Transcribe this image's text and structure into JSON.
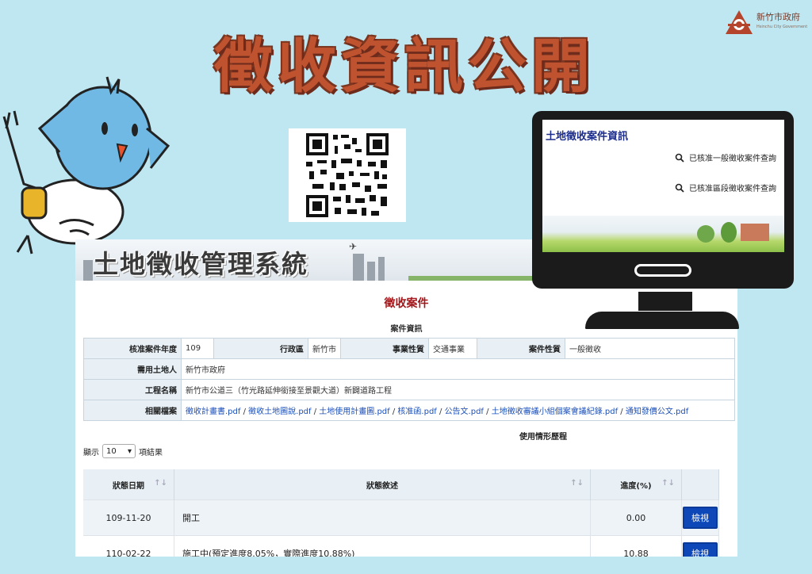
{
  "logo": {
    "name": "新竹市政府",
    "subtitle": "Hsinchu City Government"
  },
  "poster": {
    "title": "徵收資訊公開"
  },
  "system": {
    "banner_title": "土地徵收管理系統",
    "page_heading": "徵收案件",
    "section_heading": "案件資訊",
    "info": {
      "year_label": "核准案件年度",
      "year_value": "109",
      "district_label": "行政區",
      "district_value": "新竹市",
      "business_label": "事業性質",
      "business_value": "交通事業",
      "case_type_label": "案件性質",
      "case_type_value": "一般徵收",
      "land_user_label": "需用土地人",
      "land_user_value": "新竹市政府",
      "project_label": "工程名稱",
      "project_value": "新竹市公道三（竹光路延伸銜接至景觀大道）新闢道路工程",
      "files_label": "相關檔案",
      "files": [
        "徵收計畫書.pdf",
        "徵收土地圖說.pdf",
        "土地使用計畫圖.pdf",
        "核准函.pdf",
        "公告文.pdf",
        "土地徵收審議小組個案會議紀錄.pdf",
        "通知發價公文.pdf"
      ],
      "file_separator": " / "
    },
    "history_heading": "使用情形歷程",
    "length": {
      "prefix": "顯示",
      "value": "10",
      "suffix": "項結果"
    },
    "history": {
      "columns": [
        "狀態日期",
        "狀態敘述",
        "進度(%)",
        ""
      ],
      "sort_icon": "↑↓",
      "rows": [
        {
          "date": "109-11-20",
          "desc": "開工",
          "progress": "0.00",
          "action": "檢視"
        },
        {
          "date": "110-02-22",
          "desc": "施工中(預定進度8.05%，實際進度10.88%)",
          "progress": "10.88",
          "action": "檢視"
        }
      ]
    }
  },
  "monitor": {
    "title": "土地徵收案件資訊",
    "links": [
      "已核准一般徵收案件查詢",
      "已核准區段徵收案件查詢"
    ],
    "link_icon": "search-icon"
  },
  "colors": {
    "background": "#bfe7f1",
    "title": "#c0532f",
    "link": "#1c4fb8",
    "heading_red": "#a3161a",
    "button": "#0d47b8"
  }
}
